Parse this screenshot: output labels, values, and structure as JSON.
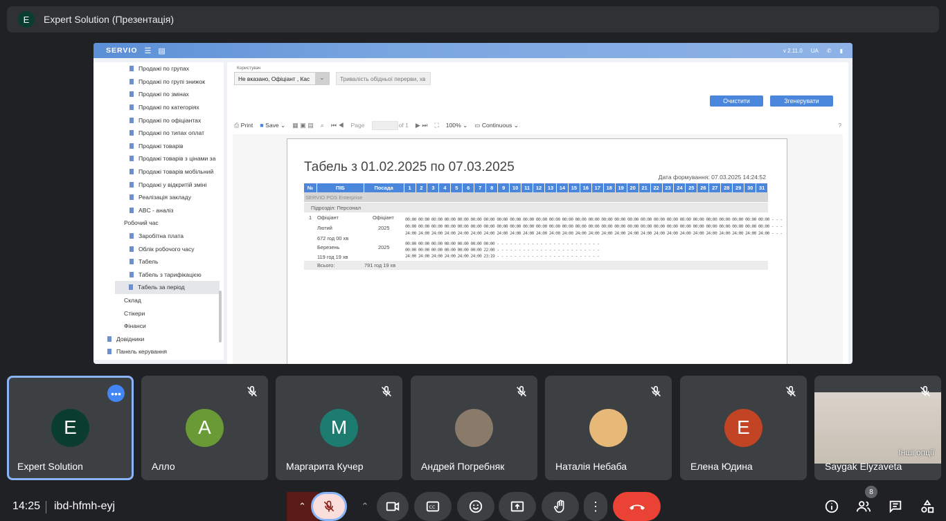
{
  "presenter_bar": {
    "avatar_letter": "E",
    "title": "Expert Solution (Презентація)"
  },
  "shared_screen": {
    "header": {
      "logo": "SERVIO",
      "version": "v 2.11.0",
      "lang": "UA"
    },
    "sidebar_items": [
      {
        "label": "Продажі по групах",
        "type": "doc"
      },
      {
        "label": "Продажі по групі знижок",
        "type": "doc"
      },
      {
        "label": "Продажі по змінах",
        "type": "doc"
      },
      {
        "label": "Продажі по категоріях",
        "type": "doc"
      },
      {
        "label": "Продажі по офіціантах",
        "type": "doc"
      },
      {
        "label": "Продажі по типах оплат",
        "type": "doc"
      },
      {
        "label": "Продажі товарів",
        "type": "doc"
      },
      {
        "label": "Продажі товарів з цінами за",
        "type": "doc"
      },
      {
        "label": "Продажі товарів мобільний",
        "type": "doc"
      },
      {
        "label": "Продажі у відкритій зміні",
        "type": "doc"
      },
      {
        "label": "Реалізація закладу",
        "type": "doc"
      },
      {
        "label": "ABC - аналіз",
        "type": "doc"
      },
      {
        "label": "Робочий час",
        "type": "folder"
      },
      {
        "label": "Заробітна плата",
        "type": "doc"
      },
      {
        "label": "Облік робочого часу",
        "type": "doc"
      },
      {
        "label": "Табель",
        "type": "doc"
      },
      {
        "label": "Табель з тарифікацією",
        "type": "doc"
      },
      {
        "label": "Табель за період",
        "type": "active"
      },
      {
        "label": "Склад",
        "type": "folder"
      },
      {
        "label": "Стікери",
        "type": "folder"
      },
      {
        "label": "Фінанси",
        "type": "folder"
      },
      {
        "label": "Довідники",
        "type": "root"
      },
      {
        "label": "Панель керування",
        "type": "root"
      }
    ],
    "filters": {
      "user_label": "Користувач",
      "user_value": "Не вказано, Офіціант , Кас",
      "break_placeholder": "Тривалість обідньої перерви, хв"
    },
    "buttons": {
      "clear": "Очистити",
      "generate": "Згенерувати"
    },
    "toolbar": {
      "print": "Print",
      "save": "Save",
      "page": "Page",
      "of": "of 1",
      "zoom": "100%",
      "mode": "Continuous",
      "help": "?"
    },
    "report": {
      "title": "Табель з 01.02.2025 по 07.03.2025",
      "generated": "Дата формування: 07.03.2025 14:24:52",
      "columns": [
        "№",
        "ПІБ",
        "Посада",
        "1",
        "2",
        "3",
        "4",
        "5",
        "6",
        "7",
        "8",
        "9",
        "10",
        "11",
        "12",
        "13",
        "14",
        "15",
        "16",
        "17",
        "18",
        "19",
        "20",
        "21",
        "22",
        "23",
        "24",
        "25",
        "26",
        "27",
        "28",
        "29",
        "30",
        "31"
      ],
      "company": "SERVIO POS Enterprise",
      "division": "Підрозділ: Персонал",
      "employee_no": "1",
      "employee_name": "Офіціант",
      "employee_position": "Офіціант",
      "month1": "Лютий",
      "year1": "2025",
      "hours1": "672 год 00 хв",
      "month2": "Березень",
      "year2": "2025",
      "hours2": "119 год 19 хв",
      "total_label": "Всього:",
      "total_value": "791 год 19 хв",
      "day_lines_feb": [
        "00:00 00:00 00:00 00:00 00:00 00:00 00:00 00:00 00:00 00:00 00:00 00:00 00:00 00:00 00:00 00:00 00:00 00:00 00:00 00:00 00:00 00:00 00:00 00:00 00:00 00:00 00:00 00:00   -     -     -",
        "00:00 00:00 00:00 00:00 00:00 00:00 00:00 00:00 00:00 00:00 00:00 00:00 00:00 00:00 00:00 00:00 00:00 00:00 00:00 00:00 00:00 00:00 00:00 00:00 00:00 00:00 00:00 00:00   -     -     -",
        "24:00 24:00 24:00 24:00 24:00 24:00 24:00 24:00 24:00 24:00 24:00 24:00 24:00 24:00 24:00 24:00 24:00 24:00 24:00 24:00 24:00 24:00 24:00 24:00 24:00 24:00 24:00 24:00   -     -     -"
      ],
      "day_lines_mar": [
        "00:00 00:00 00:00 00:00 00:00 00:00 00:00   -     -     -     -     -     -     -     -     -     -     -     -     -     -     -     -     -     -     -     -     -     -     -     -",
        "00:00 00:00 00:00 00:00 00:00 00:00 22:00   -     -     -     -     -     -     -     -     -     -     -     -     -     -     -     -     -     -     -     -     -     -     -     -",
        "24:00 24:00 24:00 24:00 24:00 24:00 23:19   -     -     -     -     -     -     -     -     -     -     -     -     -     -     -     -     -     -     -     -     -     -     -     -"
      ]
    }
  },
  "participants": [
    {
      "name": "Expert Solution",
      "letter": "E",
      "color": "#0b3d2e",
      "selected": true
    },
    {
      "name": "Алло",
      "letter": "A",
      "color": "#6a9a36"
    },
    {
      "name": "Маргарита Кучер",
      "letter": "M",
      "color": "#1c7c70"
    },
    {
      "name": "Андрей Погребняк",
      "letter": "",
      "color": "#8a7a6a"
    },
    {
      "name": "Наталія Небаба",
      "letter": "",
      "color": "#e7b978"
    },
    {
      "name": "Елена Юдина",
      "letter": "E",
      "color": "#c24424"
    },
    {
      "name": "Saygak Elyzaveta",
      "letter": "",
      "color": "#cbbfb2",
      "video": true,
      "hint": "Інші опції"
    }
  ],
  "bottom_bar": {
    "time": "14:25",
    "meeting_code": "ibd-hfmh-eyj",
    "people_count": "8"
  },
  "colors": {
    "accent_blue": "#4a86dc",
    "end_call_red": "#ea4335",
    "mic_off_pink": "#f9dedc"
  }
}
